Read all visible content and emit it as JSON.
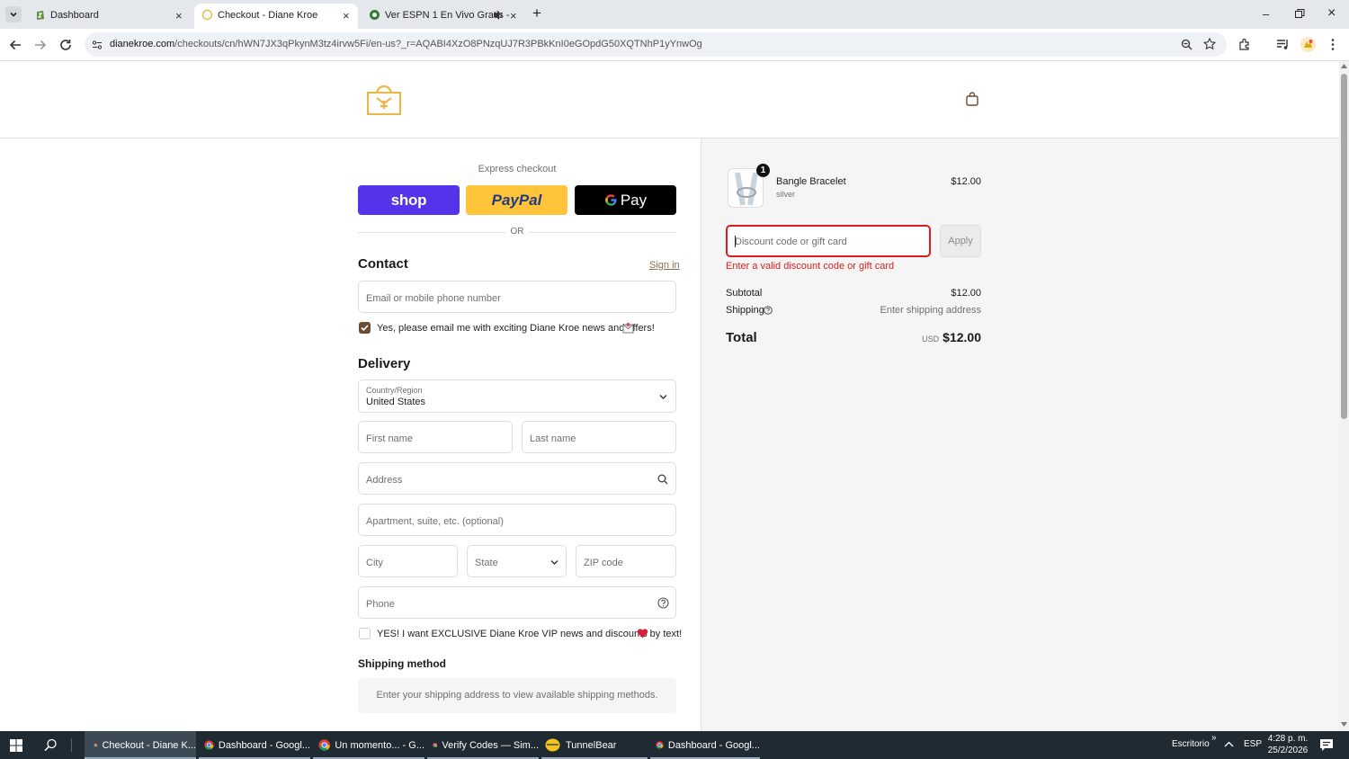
{
  "browser": {
    "tabs": [
      {
        "title": "Dashboard"
      },
      {
        "title": "Checkout - Diane Kroe"
      },
      {
        "title": "Ver ESPN 1 En Vivo Gratis -"
      }
    ],
    "url": {
      "host": "dianekroe.com",
      "path": "/checkouts/cn/hWN7JX3qPkynM3tz4irvw5Fi/en-us?_r=AQABI4XzO8PNzqUJ7R3PBkKnI0eGOpdG50XQTNhP1yYnwOg"
    }
  },
  "checkout": {
    "express_label": "Express checkout",
    "shop_label": "shop",
    "paypal_label": "PayPal",
    "gpay_label": "Pay",
    "or_label": "OR",
    "contact": {
      "heading": "Contact",
      "sign_in": "Sign in",
      "email_placeholder": "Email or mobile phone number",
      "newsletter_label": "Yes, please email me with exciting Diane Kroe news and offers!",
      "newsletter_checked": true
    },
    "delivery": {
      "heading": "Delivery",
      "country_label": "Country/Region",
      "country_value": "United States",
      "first_name": "First name",
      "last_name": "Last name",
      "address": "Address",
      "apartment": "Apartment, suite, etc. (optional)",
      "city": "City",
      "state": "State",
      "zip": "ZIP code",
      "phone": "Phone",
      "sms_label": "YES! I want EXCLUSIVE Diane Kroe VIP news and discounts by text!",
      "sms_checked": false
    },
    "shipping": {
      "heading": "Shipping method",
      "note": "Enter your shipping address to view available shipping methods."
    }
  },
  "summary": {
    "item": {
      "name": "Bangle Bracelet",
      "variant": "silver",
      "price": "$12.00",
      "quantity": "1"
    },
    "discount_placeholder": "Discount code or gift card",
    "apply_label": "Apply",
    "discount_error": "Enter a valid discount code or gift card",
    "subtotal_label": "Subtotal",
    "subtotal_value": "$12.00",
    "shipping_label": "Shipping",
    "shipping_value": "Enter shipping address",
    "total_label": "Total",
    "currency": "USD",
    "total_value": "$12.00"
  },
  "taskbar": {
    "apps": [
      {
        "label": "Checkout - Diane K..."
      },
      {
        "label": "Dashboard - Googl..."
      },
      {
        "label": "Un momento... - G..."
      },
      {
        "label": "Verify Codes — Sim..."
      },
      {
        "label": "TunnelBear"
      },
      {
        "label": "Dashboard - Googl..."
      }
    ],
    "desktop_label": "Escritorio",
    "language": "ESP",
    "time": "4:28 p. m.",
    "date": "25/2/2026"
  },
  "colors": {
    "shop_pay": "#5433eb",
    "paypal": "#ffc439",
    "gpay": "#000000",
    "error": "#dd1d1d",
    "link": "#8b6b4f",
    "checkbox": "#6b4d31"
  }
}
